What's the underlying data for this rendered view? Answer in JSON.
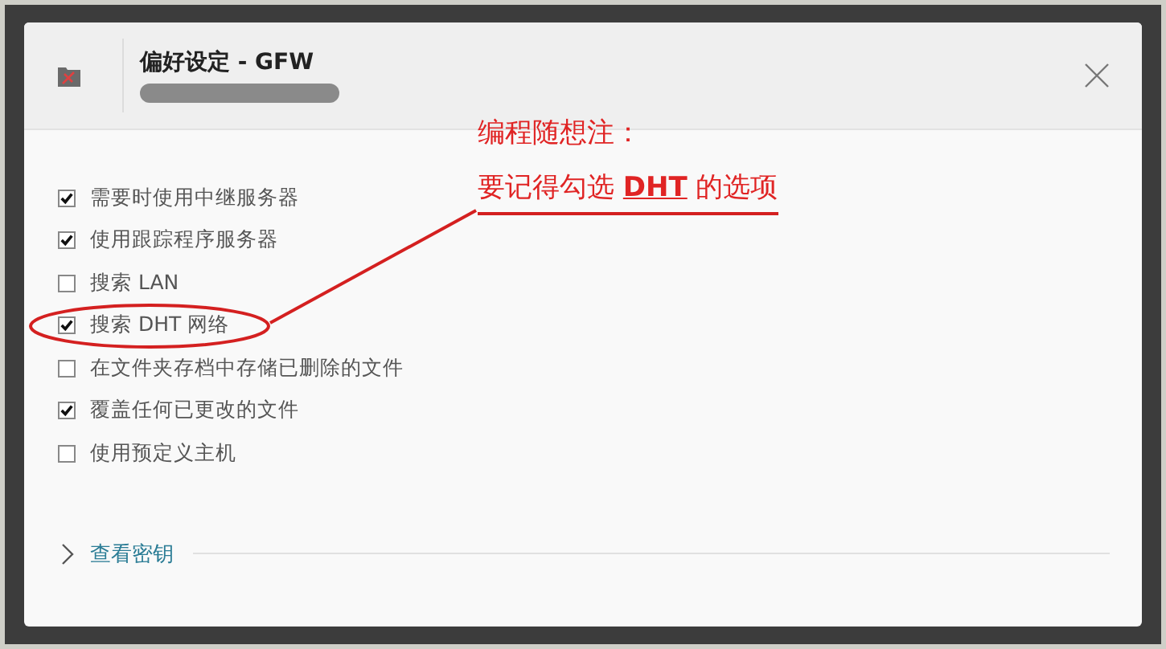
{
  "window": {
    "title": "偏好设定 - GFW"
  },
  "options": [
    {
      "label": "需要时使用中继服务器",
      "checked": true,
      "circled": false
    },
    {
      "label": "使用跟踪程序服务器",
      "checked": true,
      "circled": false
    },
    {
      "label": "搜索 LAN",
      "checked": false,
      "circled": false
    },
    {
      "label": "搜索 DHT 网络",
      "checked": true,
      "circled": true
    },
    {
      "label": "在文件夹存档中存储已删除的文件",
      "checked": false,
      "circled": false
    },
    {
      "label": "覆盖任何已更改的文件",
      "checked": true,
      "circled": false
    },
    {
      "label": "使用预定义主机",
      "checked": false,
      "circled": false
    }
  ],
  "key_section": {
    "label": "查看密钥",
    "expanded": false
  },
  "annotation": {
    "lines": [
      "编程随想注：",
      "要记得勾选 **DHT** 的选项"
    ]
  }
}
